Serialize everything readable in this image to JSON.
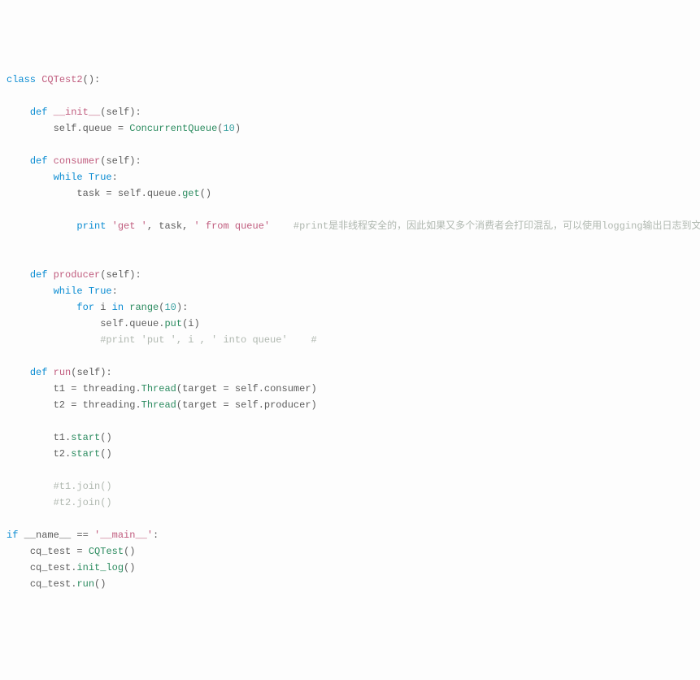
{
  "code": {
    "kw_class": "class",
    "kw_def": "def",
    "kw_while": "while",
    "kw_for": "for",
    "kw_in": "in",
    "kw_if": "if",
    "kw_True": "True",
    "cls_name": "CQTest2",
    "fn_init": "__init__",
    "fn_consumer": "consumer",
    "fn_producer": "producer",
    "fn_run": "run",
    "self": "self",
    "attr_queue": "queue",
    "call_ConcurrentQueue": "ConcurrentQueue",
    "call_get": "get",
    "call_put": "put",
    "call_range": "range",
    "call_Thread": "Thread",
    "call_start": "start",
    "call_CQTest": "CQTest",
    "call_init_log": "init_log",
    "call_run": "run",
    "attr_threading": "threading",
    "kw_print": "print",
    "num_10": "10",
    "var_task": "task",
    "var_i": "i",
    "var_t1": "t1",
    "var_t2": "t2",
    "var_cq_test": "cq_test",
    "str_get": "'get '",
    "str_from_queue": "' from queue'",
    "str_main": "'__main__'",
    "dunder_name": "__name__",
    "comment_print": "#print是非线程安全的，因此如果又多个消费者会打印混乱，可以使用logging输出日志到文件查看",
    "comment_put_line": "#print 'put ', i , ' into queue'    #",
    "comment_t1join": "#t1.join()",
    "comment_t2join": "#t2.join()",
    "param_target": "target",
    "tok_eq": " = ",
    "tok_eqeq": " == ",
    "tok_comma": ", ",
    "tok_colon": ":",
    "tok_dot": ".",
    "tok_op": "(",
    "tok_cp": ")"
  }
}
